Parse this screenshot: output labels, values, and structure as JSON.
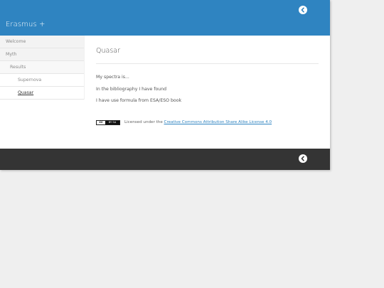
{
  "header": {
    "site_title": "Erasmus +"
  },
  "sidebar": {
    "items": [
      {
        "label": "Welcome"
      },
      {
        "label": "Myth"
      },
      {
        "label": "Results"
      },
      {
        "label": "Supernova"
      },
      {
        "label": "Quasar"
      }
    ]
  },
  "main": {
    "title": "Quasar",
    "paragraphs": [
      "My spectra is...",
      "In the bibliography I have found",
      "I have use formula from ESA/ESO book"
    ],
    "license": {
      "badge_left": "cc",
      "badge_right": "BY SA",
      "prefix": "Licensed under the ",
      "link_text": "Creative Commons Attribution Share Alike License 4.0"
    }
  },
  "icons": {
    "top_back": "chevron-left-circle-icon",
    "bottom_back": "chevron-left-circle-icon"
  },
  "colors": {
    "header": "#2f84c1",
    "footer": "#343434",
    "link": "#2f84c1",
    "page_background": "#efefef"
  }
}
